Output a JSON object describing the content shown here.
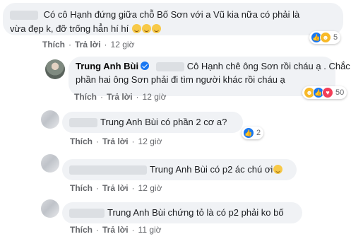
{
  "comments": [
    {
      "line1": "Có cô Hạnh đứng giữa chỗ Bố Sơn với a Vũ kia nữa có phải là",
      "line2": "vừa đẹp k, đỡ trống hẳn hí hí",
      "reaction_count": "5",
      "actions": {
        "like": "Thích",
        "reply": "Trả lời",
        "time": "12 giờ"
      }
    },
    {
      "author": "Trung Anh Bùi",
      "line1": "Cô Hạnh chê ông Sơn rồi cháu ạ . Chắc",
      "line2": "phần hai ông Sơn phải đi tìm người khác rồi cháu ạ",
      "reaction_count": "50",
      "actions": {
        "like": "Thích",
        "reply": "Trả lời",
        "time": "12 giờ"
      }
    },
    {
      "text": "Trung Anh Bùi có phần 2 cơ a?",
      "reaction_count": "2",
      "actions": {
        "like": "Thích",
        "reply": "Trả lời",
        "time": "12 giờ"
      }
    },
    {
      "text": "Trung Anh Bùi có p2 ác chú ơi",
      "actions": {
        "like": "Thích",
        "reply": "Trả lời",
        "time": "12 giờ"
      }
    },
    {
      "text": "Trung Anh Bùi chứng tỏ là có p2 phải ko bố",
      "actions": {
        "like": "Thích",
        "reply": "Trả lời",
        "time": "11 giờ"
      }
    }
  ],
  "icons": {
    "like": "like-reaction-icon",
    "haha": "haha-reaction-icon",
    "love": "love-reaction-icon",
    "verified": "verified-badge-icon",
    "emoji": "smiling-emoji-icon"
  },
  "colors": {
    "bubble": "#f0f2f5",
    "meta": "#65676b",
    "like_blue": "#1877f2"
  }
}
